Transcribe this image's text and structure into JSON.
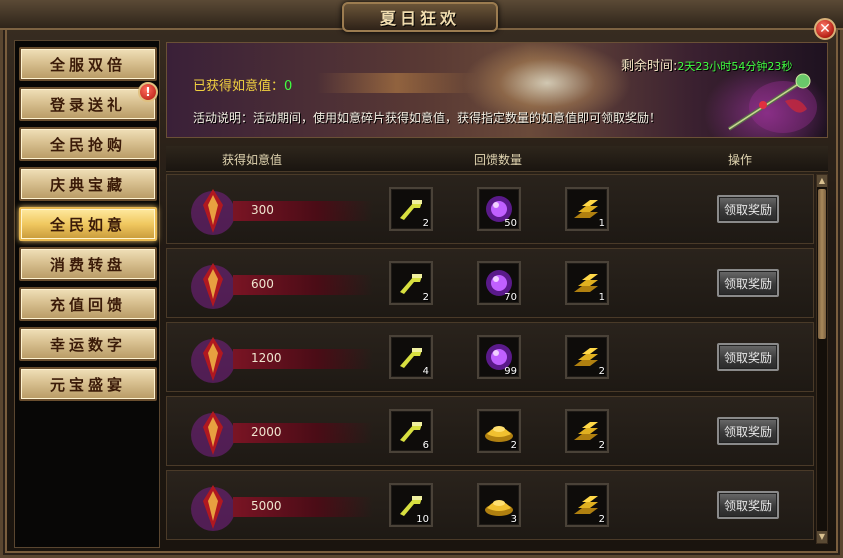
{
  "window": {
    "title": "夏日狂欢"
  },
  "sidebar": {
    "items": [
      {
        "label": "全服双倍",
        "active": false
      },
      {
        "label": "登录送礼",
        "active": false,
        "alert": "!"
      },
      {
        "label": "全民抢购",
        "active": false
      },
      {
        "label": "庆典宝藏",
        "active": false
      },
      {
        "label": "全民如意",
        "active": true
      },
      {
        "label": "消费转盘",
        "active": false
      },
      {
        "label": "充值回馈",
        "active": false
      },
      {
        "label": "幸运数字",
        "active": false
      },
      {
        "label": "元宝盛宴",
        "active": false
      }
    ]
  },
  "banner": {
    "ruyi_label": "已获得如意值：",
    "ruyi_value": "0",
    "desc_label": "活动说明：",
    "desc_text": "活动期间，使用如意碎片获得如意值，获得指定数量的如意值即可领取奖励！",
    "remain_label": "剩余时间:",
    "remain_value": "2天23小时54分钟23秒"
  },
  "table": {
    "headers": {
      "threshold": "获得如意值",
      "rewards": "回馈数量",
      "action": "操作"
    },
    "claim_label": "领取奖励",
    "rows": [
      {
        "threshold": "300",
        "rewards": [
          {
            "icon": "scroll-icon",
            "qty": "2"
          },
          {
            "icon": "purple-orb-icon",
            "qty": "50"
          },
          {
            "icon": "gold-bars-icon",
            "qty": "1"
          }
        ]
      },
      {
        "threshold": "600",
        "rewards": [
          {
            "icon": "scroll-icon",
            "qty": "2"
          },
          {
            "icon": "purple-orb-icon",
            "qty": "70"
          },
          {
            "icon": "gold-bars-icon",
            "qty": "1"
          }
        ]
      },
      {
        "threshold": "1200",
        "rewards": [
          {
            "icon": "scroll-icon",
            "qty": "4"
          },
          {
            "icon": "purple-orb-icon",
            "qty": "99"
          },
          {
            "icon": "gold-bars-icon",
            "qty": "2"
          }
        ]
      },
      {
        "threshold": "2000",
        "rewards": [
          {
            "icon": "scroll-icon",
            "qty": "6"
          },
          {
            "icon": "gold-ingot-icon",
            "qty": "2"
          },
          {
            "icon": "gold-bars-icon",
            "qty": "2"
          }
        ]
      },
      {
        "threshold": "5000",
        "rewards": [
          {
            "icon": "scroll-icon",
            "qty": "10"
          },
          {
            "icon": "gold-ingot-icon",
            "qty": "3"
          },
          {
            "icon": "gold-bars-icon",
            "qty": "2"
          }
        ]
      }
    ]
  },
  "close": {
    "label": "✕"
  }
}
